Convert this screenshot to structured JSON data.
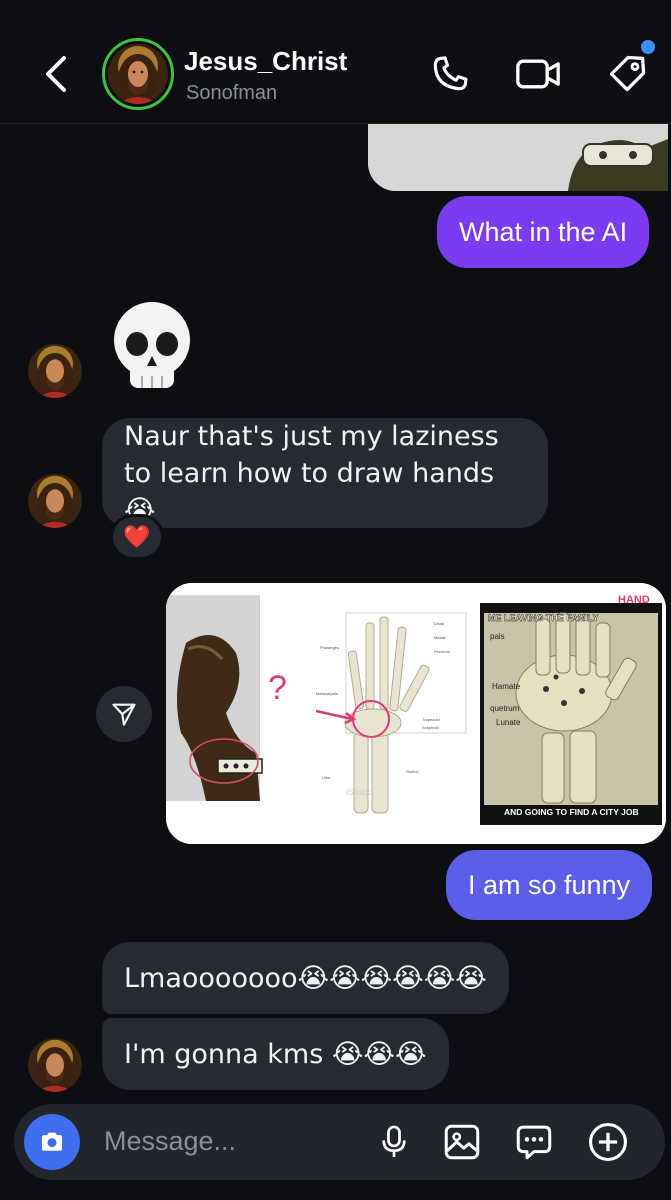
{
  "header": {
    "contact_name": "Jesus_Christ",
    "contact_subtitle": "Sonofman",
    "icons": [
      "back-chevron-icon",
      "phone-icon",
      "video-icon",
      "tag-icon"
    ],
    "notification_dot_color": "#3a8ef6",
    "avatar_ring_color": "#3ec13e"
  },
  "messages": {
    "m1_out": "What in the AI",
    "m2_in_emoji": "💀",
    "m3_in": "Naur that's just my laziness to learn how to draw hands 😭",
    "m3_reaction": "❤️",
    "m4_out": "I am so funny",
    "m5_in": "Lmaooooooo😭😭😭😭😭😭",
    "m6_in": "I'm gonna kms 😭😭😭"
  },
  "collage": {
    "meme_top": "ME LEAVING THE FAMILY",
    "meme_top_handwritten": "HAND",
    "meme_bottom": "AND GOING TO FIND A CITY JOB",
    "meme_labels": [
      "pals",
      "Hamate",
      "quetrum",
      "Lunate"
    ],
    "annotation_mark": "?",
    "watermark": "iStock"
  },
  "composer": {
    "placeholder": "Message..."
  },
  "colors": {
    "background": "#0c0e12",
    "outgoing_bubble": "#7b3bf3",
    "outgoing_bubble_2": "#5a5ee8",
    "incoming_bubble": "#262a31",
    "camera_button": "#3f6ff0"
  }
}
